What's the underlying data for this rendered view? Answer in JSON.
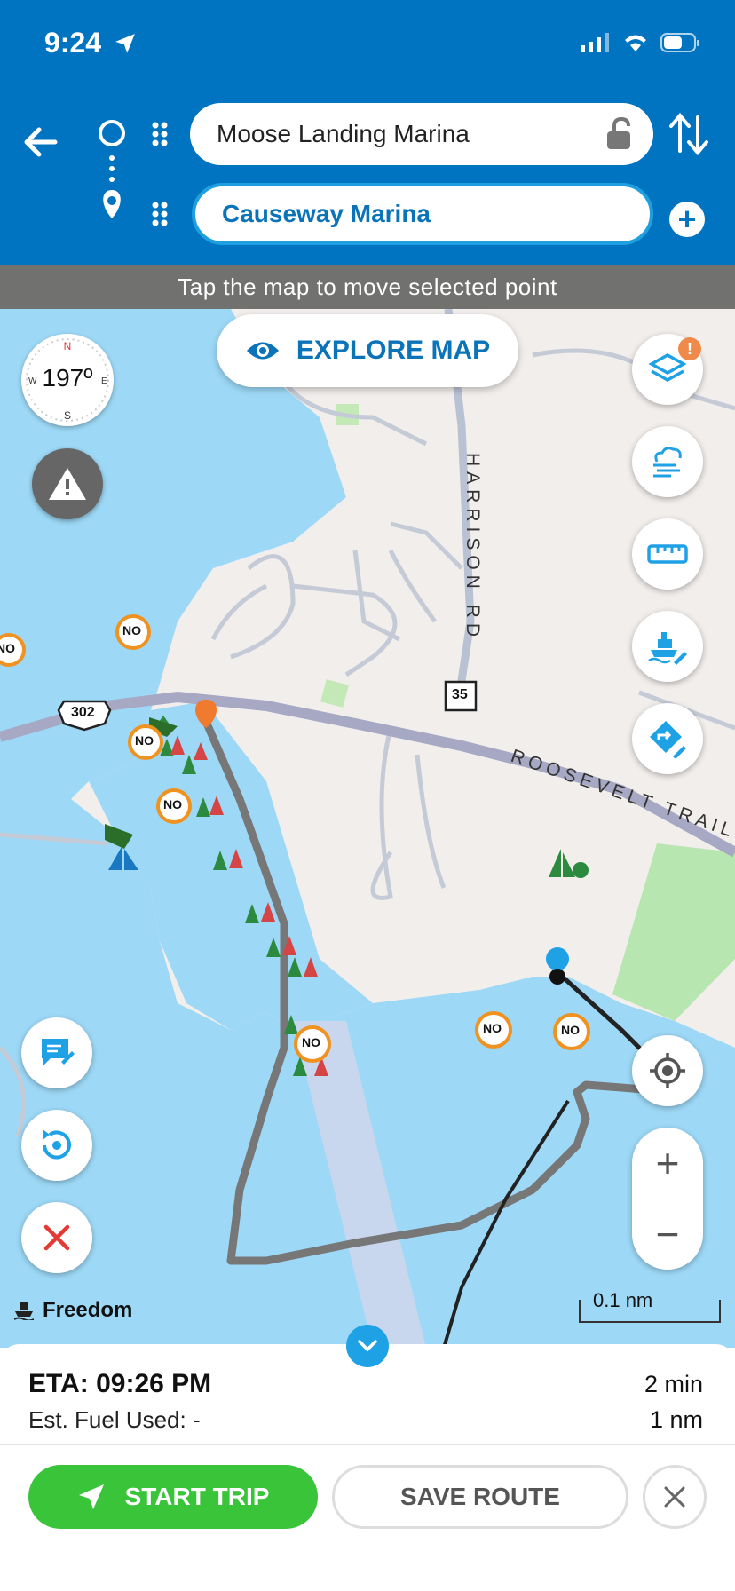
{
  "status_bar": {
    "time": "9:24"
  },
  "route": {
    "origin": "Moose Landing Marina",
    "destination": "Causeway Marina"
  },
  "hint": "Tap the map to move selected point",
  "explore_button": "EXPLORE MAP",
  "compass": {
    "heading": "197º"
  },
  "map_labels": {
    "road_harrison": "HARRISON RD",
    "road_roosevelt": "ROOSEVELT TRAIL",
    "shield_302": "302",
    "shield_35": "35",
    "no_wake": "NO"
  },
  "layers_badge": "!",
  "vessel_name": "Freedom",
  "scale": "0.1 nm",
  "trip": {
    "eta": "ETA: 09:26 PM",
    "fuel": "Est. Fuel Used: -",
    "duration": "2 min",
    "distance": "1 nm"
  },
  "actions": {
    "start": "START TRIP",
    "save": "SAVE ROUTE"
  },
  "colors": {
    "header": "#0074c0",
    "water": "#9dd9f7",
    "land": "#f1eeec",
    "start": "#3ac43a",
    "accent": "#1fa1e6"
  }
}
